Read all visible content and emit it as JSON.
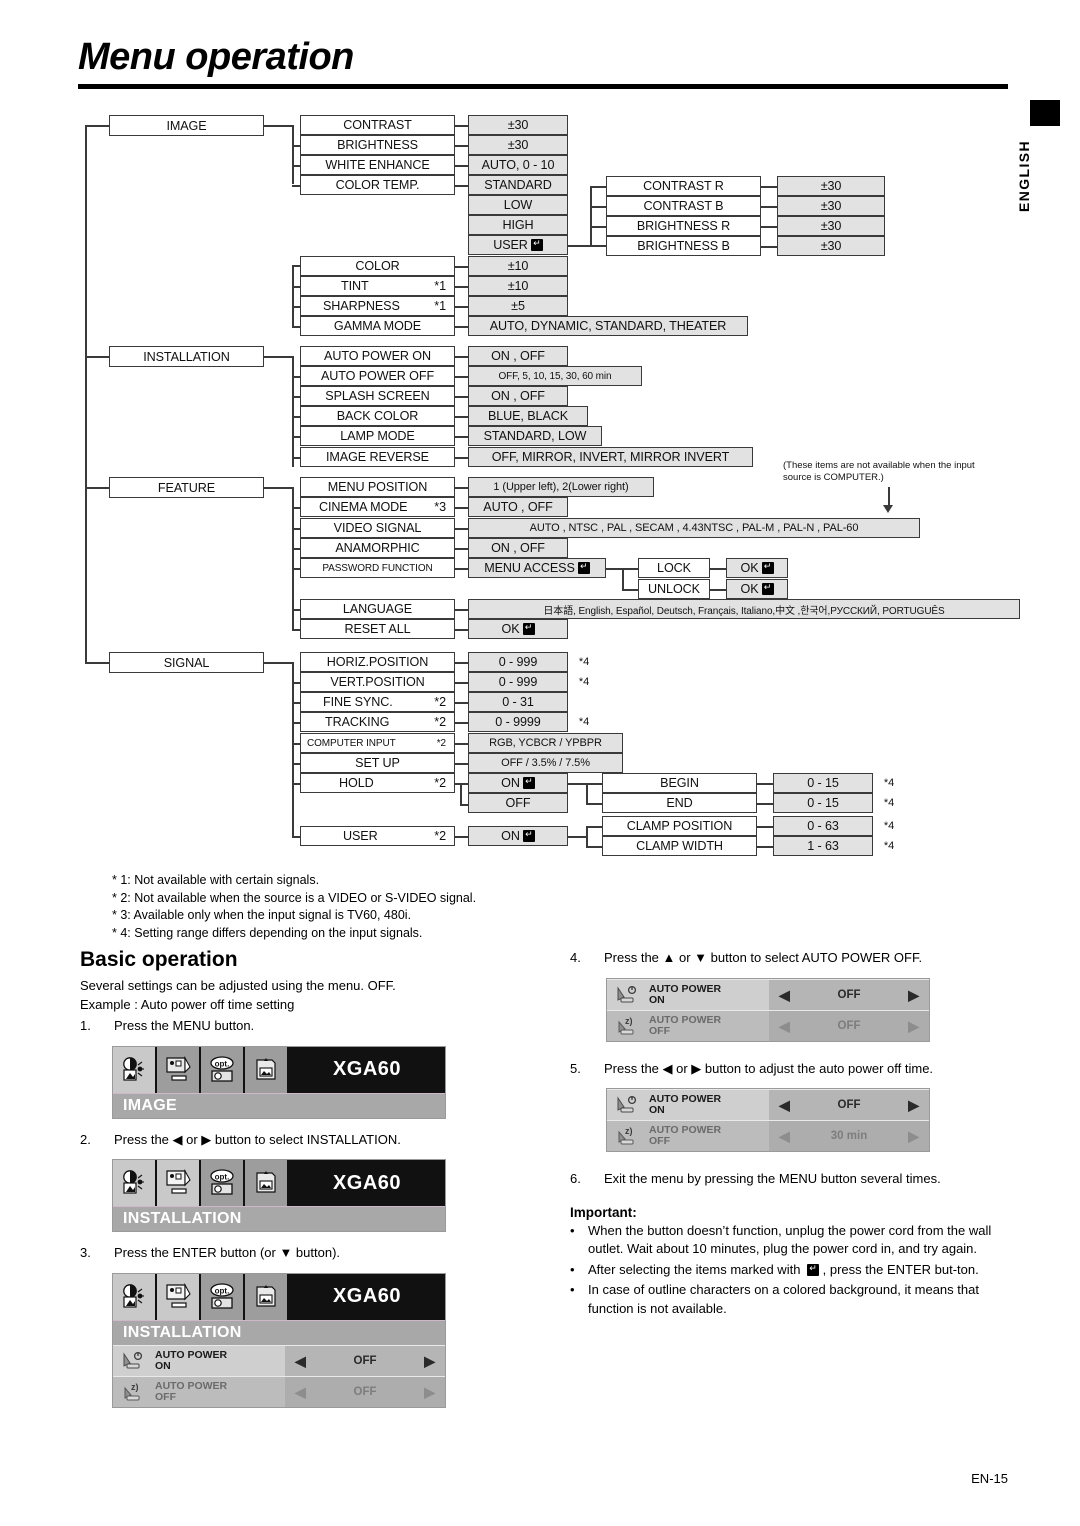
{
  "page": {
    "title": "Menu operation",
    "side_tab": "ENGLISH",
    "footer": "EN-15"
  },
  "tree": {
    "roots": [
      "IMAGE",
      "INSTALLATION",
      "FEATURE",
      "SIGNAL"
    ],
    "image": {
      "items": [
        {
          "label": "CONTRAST",
          "note": "",
          "value": "±30"
        },
        {
          "label": "BRIGHTNESS",
          "note": "",
          "value": "±30"
        },
        {
          "label": "WHITE ENHANCE",
          "note": "",
          "value": "AUTO, 0 - 10"
        },
        {
          "label": "COLOR TEMP.",
          "note": "",
          "value": "STANDARD"
        },
        {
          "label": "COLOR",
          "note": "",
          "value": "±10"
        },
        {
          "label": "TINT",
          "note": "*1",
          "value": "±10"
        },
        {
          "label": "SHARPNESS",
          "note": "*1",
          "value": "±5"
        },
        {
          "label": "GAMMA MODE",
          "note": "",
          "value": "AUTO, DYNAMIC, STANDARD, THEATER"
        }
      ],
      "color_temp_values": [
        "STANDARD",
        "LOW",
        "HIGH",
        "USER"
      ],
      "user_sub": [
        {
          "label": "CONTRAST R",
          "value": "±30"
        },
        {
          "label": "CONTRAST B",
          "value": "±30"
        },
        {
          "label": "BRIGHTNESS R",
          "value": "±30"
        },
        {
          "label": "BRIGHTNESS B",
          "value": "±30"
        }
      ]
    },
    "installation": {
      "items": [
        {
          "label": "AUTO POWER ON",
          "value": "ON , OFF"
        },
        {
          "label": "AUTO POWER OFF",
          "value": "OFF,  5,  10,  15,  30,  60 min"
        },
        {
          "label": "SPLASH SCREEN",
          "value": "ON , OFF"
        },
        {
          "label": "BACK COLOR",
          "value": "BLUE, BLACK"
        },
        {
          "label": "LAMP MODE",
          "value": "STANDARD, LOW"
        },
        {
          "label": "IMAGE REVERSE",
          "value": "OFF, MIRROR, INVERT, MIRROR INVERT"
        }
      ]
    },
    "computer_note": "(These items are not available when the input source is COMPUTER.)",
    "feature": {
      "items": [
        {
          "label": "MENU POSITION",
          "note": "",
          "value": "1 (Upper left), 2(Lower right)"
        },
        {
          "label": "CINEMA MODE",
          "note": "*3",
          "value": "AUTO , OFF"
        },
        {
          "label": "VIDEO SIGNAL",
          "note": "",
          "value": "AUTO , NTSC , PAL , SECAM , 4.43NTSC , PAL-M , PAL-N , PAL-60"
        },
        {
          "label": "ANAMORPHIC",
          "note": "",
          "value": "ON , OFF"
        },
        {
          "label": "PASSWORD FUNCTION",
          "note": "",
          "value": "MENU ACCESS"
        },
        {
          "label": "LANGUAGE",
          "note": "",
          "value": "日本語, English, Español, Deutsch, Français, Italiano,中文 ,한국어,РУССКИЙ, PORTUGUÊS"
        },
        {
          "label": "RESET ALL",
          "note": "",
          "value": "OK"
        }
      ],
      "password_sub": [
        {
          "label": "LOCK",
          "value": "OK"
        },
        {
          "label": "UNLOCK",
          "value": "OK"
        }
      ]
    },
    "signal": {
      "items": [
        {
          "label": "HORIZ.POSITION",
          "note": "",
          "value": "0 - 999",
          "fn": "*4"
        },
        {
          "label": "VERT.POSITION",
          "note": "",
          "value": "0 - 999",
          "fn": "*4"
        },
        {
          "label": "FINE SYNC.",
          "note": "*2",
          "value": "0 - 31",
          "fn": ""
        },
        {
          "label": "TRACKING",
          "note": "*2",
          "value": "0 - 9999",
          "fn": "*4"
        },
        {
          "label": "COMPUTER INPUT",
          "note": "*2",
          "value": "RGB, YCBCR / YPBPR",
          "fn": ""
        },
        {
          "label": "SET UP",
          "note": "",
          "value": "OFF / 3.5% / 7.5%",
          "fn": ""
        },
        {
          "label": "HOLD",
          "note": "*2",
          "value": "ON",
          "fn": ""
        },
        {
          "label": "USER",
          "note": "*2",
          "value": "ON",
          "fn": ""
        }
      ],
      "hold_values": [
        "ON",
        "OFF"
      ],
      "hold_sub": [
        {
          "label": "BEGIN",
          "value": "0 - 15",
          "fn": "*4"
        },
        {
          "label": "END",
          "value": "0 - 15",
          "fn": "*4"
        }
      ],
      "user_sub": [
        {
          "label": "CLAMP POSITION",
          "value": "0 - 63",
          "fn": "*4"
        },
        {
          "label": "CLAMP WIDTH",
          "value": "1 - 63",
          "fn": "*4"
        }
      ]
    },
    "footnotes": [
      "* 1: Not available with certain signals.",
      "* 2: Not available when the source is a VIDEO or S-VIDEO signal.",
      "* 3: Available only when the input signal is TV60, 480i.",
      "* 4: Setting range differs depending on the input signals."
    ]
  },
  "basic_operation": {
    "heading": "Basic operation",
    "intro1": "Several settings can be adjusted using the menu. OFF.",
    "intro2": "Example : Auto power off time setting",
    "steps": [
      {
        "num": "1.",
        "text": "Press the MENU button."
      },
      {
        "num": "2.",
        "text": "Press the ◀ or ▶ button to select INSTALLATION."
      },
      {
        "num": "3.",
        "text": "Press the ENTER button (or ▼ button)."
      },
      {
        "num": "4.",
        "text": "Press the ▲ or ▼ button to select AUTO POWER OFF."
      },
      {
        "num": "5.",
        "text": "Press the ◀ or ▶ button to adjust the auto power off time."
      },
      {
        "num": "6.",
        "text": "Exit the menu by pressing the MENU button several times."
      }
    ]
  },
  "osd": {
    "signal_name": "XGA60",
    "tab_names": [
      "image-tab-icon",
      "installation-tab-icon",
      "feature-tab-icon",
      "signal-tab-icon"
    ],
    "menu1": {
      "sub": "IMAGE",
      "selected_tab": 0
    },
    "menu2": {
      "sub": "INSTALLATION",
      "selected_tab": 1
    },
    "menu3": {
      "sub": "INSTALLATION",
      "selected_tab": 1,
      "rows": [
        {
          "l1": "AUTO POWER",
          "l2": "ON",
          "value": "OFF",
          "state": "on"
        },
        {
          "l1": "AUTO POWER",
          "l2": "OFF",
          "value": "OFF",
          "state": "off"
        }
      ]
    },
    "menu4": {
      "rows": [
        {
          "l1": "AUTO POWER",
          "l2": "ON",
          "value": "OFF",
          "state": "on"
        },
        {
          "l1": "AUTO POWER",
          "l2": "OFF",
          "value": "OFF",
          "state": "off"
        }
      ]
    },
    "menu5": {
      "rows": [
        {
          "l1": "AUTO POWER",
          "l2": "ON",
          "value": "OFF",
          "state": "on"
        },
        {
          "l1": "AUTO POWER",
          "l2": "OFF",
          "value": "30 min",
          "state": "off"
        }
      ]
    },
    "arrow_left": "◀",
    "arrow_right": "▶"
  },
  "important": {
    "title": "Important:",
    "bullets": [
      "When the button doesn’t function, unplug the power cord from the wall outlet. Wait about 10 minutes, plug the power cord in, and try again.",
      "After selecting the items marked with   , press the ENTER but-ton.",
      "In case of outline characters on a colored background, it means that function is not available."
    ],
    "bullet_mark": "•"
  }
}
